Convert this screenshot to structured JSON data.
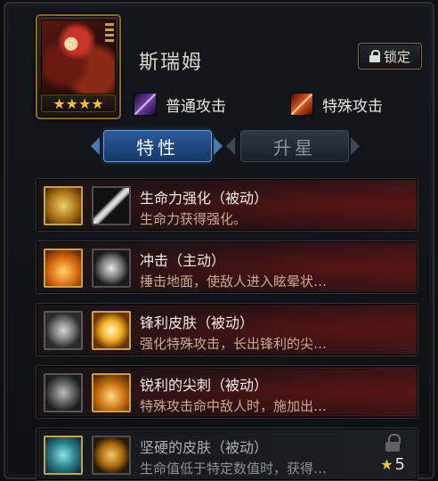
{
  "hero": {
    "name": "斯瑞姆",
    "stars": "★★★★",
    "lock_label": "锁定"
  },
  "attacks": {
    "normal": "普通攻击",
    "special": "特殊攻击"
  },
  "tabs": [
    {
      "label": "特性",
      "active": true
    },
    {
      "label": "升星",
      "active": false
    }
  ],
  "skills": [
    {
      "title": "生命力强化（被动）",
      "desc": "生命力获得强化。",
      "icon_a": "heart-aura-icon",
      "icon_b": "sword-icon",
      "locked": false
    },
    {
      "title": "冲击（主动）",
      "desc": "捶击地面，使敌人进入眩晕状…",
      "icon_a": "fire-burst-icon",
      "icon_b": "smash-icon",
      "locked": false
    },
    {
      "title": "锋利皮肤（被动）",
      "desc": "强化特殊攻击，长出锋利的尖…",
      "icon_a": "whirlwind-icon",
      "icon_b": "spike-star-icon",
      "locked": false
    },
    {
      "title": "锐利的尖刺（被动）",
      "desc": "特殊攻击命中敌人时，施加出…",
      "icon_a": "claw-icon",
      "icon_b": "flame-drop-icon",
      "locked": false
    },
    {
      "title": "坚硬的皮肤（被动）",
      "desc": "生命值低于特定数值时，获得…",
      "icon_a": "shield-icon",
      "icon_b": "teeth-icon",
      "locked": true,
      "requirement_stars": "5"
    }
  ]
}
